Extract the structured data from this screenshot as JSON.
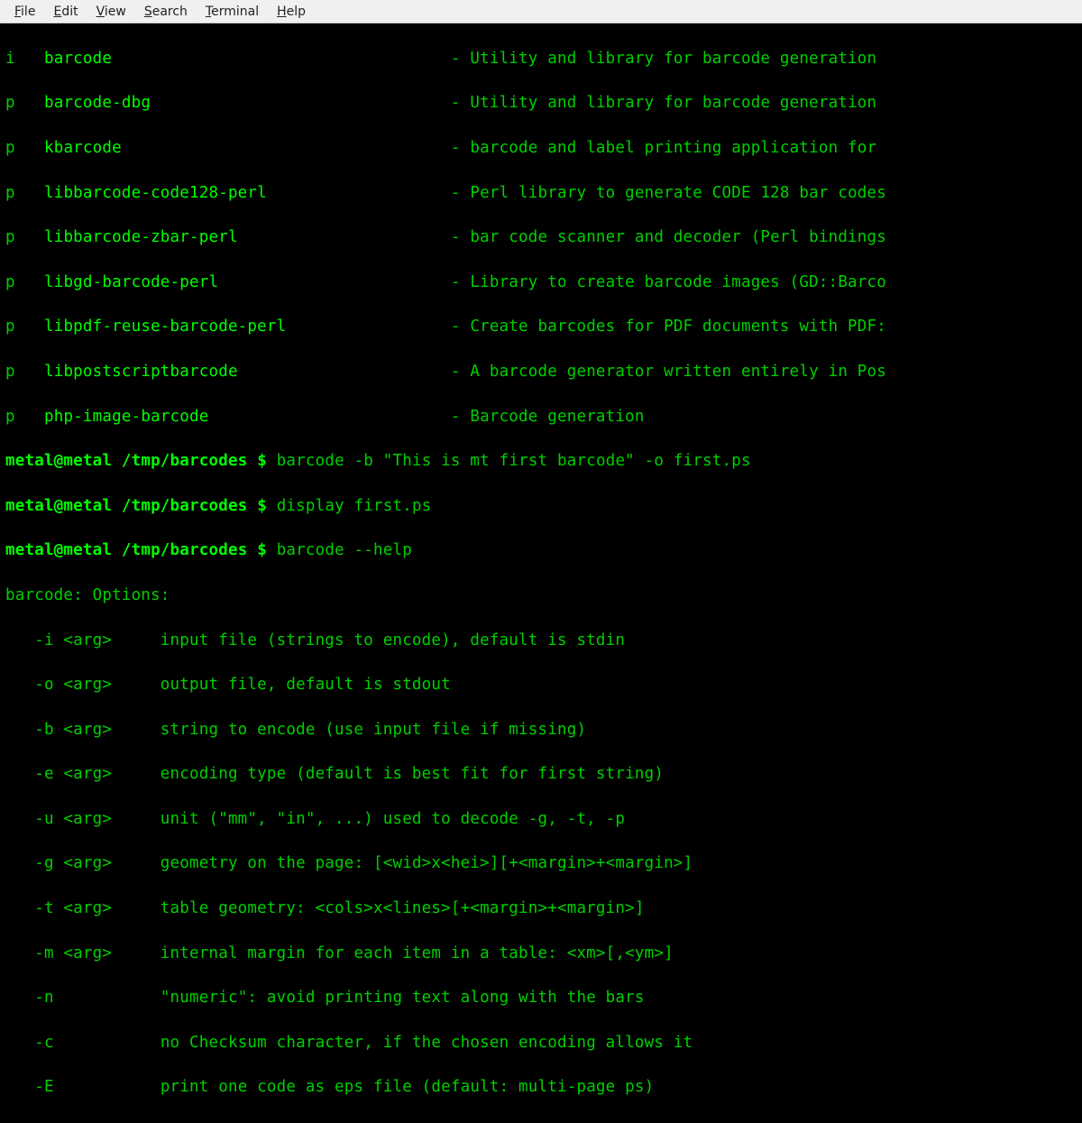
{
  "menubar": [
    {
      "label": "File",
      "u": "F"
    },
    {
      "label": "Edit",
      "u": "E"
    },
    {
      "label": "View",
      "u": "V"
    },
    {
      "label": "Search",
      "u": "S"
    },
    {
      "label": "Terminal",
      "u": "T"
    },
    {
      "label": "Help",
      "u": "H"
    }
  ],
  "packages": [
    {
      "status": "i",
      "name": "barcode",
      "desc": "Utility and library for barcode generation"
    },
    {
      "status": "p",
      "name": "barcode-dbg",
      "desc": "Utility and library for barcode generation"
    },
    {
      "status": "p",
      "name": "kbarcode",
      "desc": "barcode and label printing application for"
    },
    {
      "status": "p",
      "name": "libbarcode-code128-perl",
      "desc": "Perl library to generate CODE 128 bar codes"
    },
    {
      "status": "p",
      "name": "libbarcode-zbar-perl",
      "desc": "bar code scanner and decoder (Perl bindings"
    },
    {
      "status": "p",
      "name": "libgd-barcode-perl",
      "desc": "Library to create barcode images (GD::Barco"
    },
    {
      "status": "p",
      "name": "libpdf-reuse-barcode-perl",
      "desc": "Create barcodes for PDF documents with PDF:"
    },
    {
      "status": "p",
      "name": "libpostscriptbarcode",
      "desc": "A barcode generator written entirely in Pos"
    },
    {
      "status": "p",
      "name": "php-image-barcode",
      "desc": "Barcode generation"
    }
  ],
  "prompt": {
    "user": "metal@metal",
    "path": "/tmp/barcodes",
    "symbol": "$"
  },
  "commands": [
    "barcode -b \"This is mt first barcode\" -o first.ps",
    "display first.ps",
    "barcode --help"
  ],
  "helpheader": "barcode: Options:",
  "options": [
    {
      "flag": "-i <arg>",
      "desc": "input file (strings to encode), default is stdin"
    },
    {
      "flag": "-o <arg>",
      "desc": "output file, default is stdout"
    },
    {
      "flag": "-b <arg>",
      "desc": "string to encode (use input file if missing)"
    },
    {
      "flag": "-e <arg>",
      "desc": "encoding type (default is best fit for first string)"
    },
    {
      "flag": "-u <arg>",
      "desc": "unit (\"mm\", \"in\", ...) used to decode -g, -t, -p"
    },
    {
      "flag": "-g <arg>",
      "desc": "geometry on the page: [<wid>x<hei>][+<margin>+<margin>]"
    },
    {
      "flag": "-t <arg>",
      "desc": "table geometry: <cols>x<lines>[+<margin>+<margin>]"
    },
    {
      "flag": "-m <arg>",
      "desc": "internal margin for each item in a table: <xm>[,<ym>]"
    },
    {
      "flag": "-n",
      "desc": "\"numeric\": avoid printing text along with the bars"
    },
    {
      "flag": "-c",
      "desc": "no Checksum character, if the chosen encoding allows it"
    },
    {
      "flag": "-E",
      "desc": "print one code as eps file (default: multi-page ps)"
    }
  ]
}
